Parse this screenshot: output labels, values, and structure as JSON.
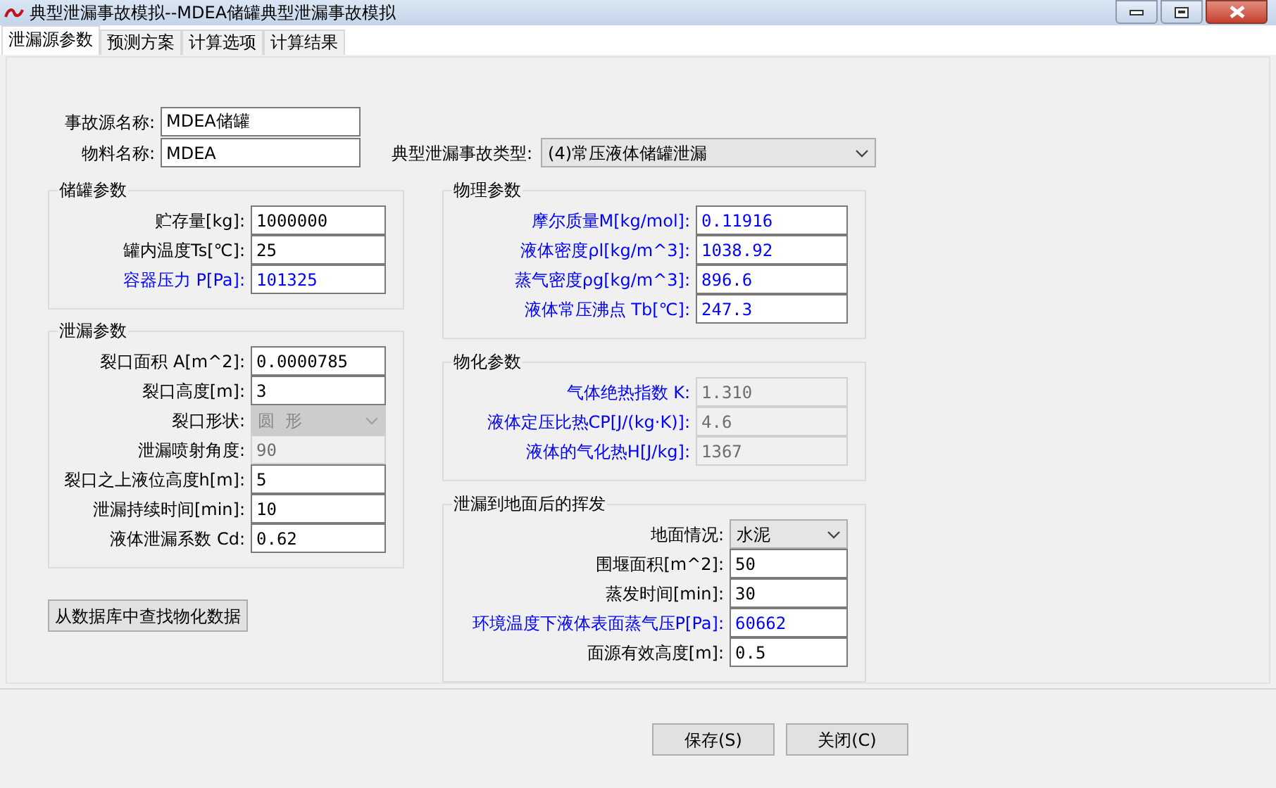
{
  "window": {
    "title": "典型泄漏事故模拟--MDEA储罐典型泄漏事故模拟"
  },
  "tabs": [
    {
      "label": "泄漏源参数",
      "selected": true
    },
    {
      "label": "预测方案",
      "selected": false
    },
    {
      "label": "计算选项",
      "selected": false
    },
    {
      "label": "计算结果",
      "selected": false
    }
  ],
  "source": {
    "name_label": "事故源名称:",
    "name_value": "MDEA储罐",
    "material_label": "物料名称:",
    "material_value": "MDEA",
    "type_label": "典型泄漏事故类型:",
    "type_value": "(4)常压液体储罐泄漏"
  },
  "left_groups": [
    {
      "title": "储罐参数",
      "fields": [
        {
          "kind": "input",
          "label": "贮存量[kg]:",
          "value": "1000000",
          "color": "#000000",
          "disabled": false
        },
        {
          "kind": "input",
          "label": "罐内温度Ts[℃]:",
          "value": "25",
          "color": "#000000",
          "disabled": false
        },
        {
          "kind": "input",
          "label": "容器压力 P[Pa]:",
          "value": "101325",
          "color": "#0000ff",
          "disabled": false
        }
      ]
    },
    {
      "title": "泄漏参数",
      "fields": [
        {
          "kind": "input",
          "label": "裂口面积 A[m^2]:",
          "value": "0.0000785",
          "color": "#000000",
          "disabled": false
        },
        {
          "kind": "input",
          "label": "裂口高度[m]:",
          "value": "3",
          "color": "#000000",
          "disabled": false
        },
        {
          "kind": "select",
          "label": "裂口形状:",
          "value": "圆  形",
          "color": "#000000",
          "disabled": true
        },
        {
          "kind": "input",
          "label": "泄漏喷射角度:",
          "value": "90",
          "color": "#000000",
          "disabled": true
        },
        {
          "kind": "input",
          "label": "裂口之上液位高度h[m]:",
          "value": "5",
          "color": "#000000",
          "disabled": false
        },
        {
          "kind": "input",
          "label": "泄漏持续时间[min]:",
          "value": "10",
          "color": "#000000",
          "disabled": false
        },
        {
          "kind": "input",
          "label": "液体泄漏系数  Cd:",
          "value": "0.62",
          "color": "#000000",
          "disabled": false
        }
      ]
    }
  ],
  "right_groups": [
    {
      "title": "物理参数",
      "fields": [
        {
          "kind": "input",
          "label": "摩尔质量M[kg/mol]:",
          "value": "0.11916",
          "color": "#0000ff",
          "disabled": false
        },
        {
          "kind": "input",
          "label": "液体密度ρl[kg/m^3]:",
          "value": "1038.92",
          "color": "#0000ff",
          "disabled": false
        },
        {
          "kind": "input",
          "label": "蒸气密度ρg[kg/m^3]:",
          "value": "896.6",
          "color": "#0000ff",
          "disabled": false
        },
        {
          "kind": "input",
          "label": "液体常压沸点 Tb[℃]:",
          "value": "247.3",
          "color": "#0000ff",
          "disabled": false
        }
      ]
    },
    {
      "title": "物化参数",
      "fields": [
        {
          "kind": "input",
          "label": "气体绝热指数 K:",
          "value": "1.310",
          "color": "#0000ff",
          "disabled": true
        },
        {
          "kind": "input",
          "label": "液体定压比热CP[J/(kg·K)]:",
          "value": "4.6",
          "color": "#0000ff",
          "disabled": true
        },
        {
          "kind": "input",
          "label": "液体的气化热H[J/kg]:",
          "value": "1367",
          "color": "#0000ff",
          "disabled": true
        }
      ]
    },
    {
      "title": "泄漏到地面后的挥发",
      "fields": [
        {
          "kind": "select",
          "label": "地面情况:",
          "value": "水泥",
          "color": "#000000",
          "disabled": false
        },
        {
          "kind": "input",
          "label": "围堰面积[m^2]:",
          "value": "50",
          "color": "#000000",
          "disabled": false
        },
        {
          "kind": "input",
          "label": "蒸发时间[min]:",
          "value": "30",
          "color": "#000000",
          "disabled": false
        },
        {
          "kind": "input",
          "label": "环境温度下液体表面蒸气压P[Pa]:",
          "value": "60662",
          "color": "#0000ff",
          "disabled": false
        },
        {
          "kind": "input",
          "label": "面源有效高度[m]:",
          "value": "0.5",
          "color": "#000000",
          "disabled": false
        }
      ]
    }
  ],
  "lookup_button": "从数据库中查找物化数据",
  "buttons": [
    "保存(S)",
    "关闭(C)"
  ]
}
